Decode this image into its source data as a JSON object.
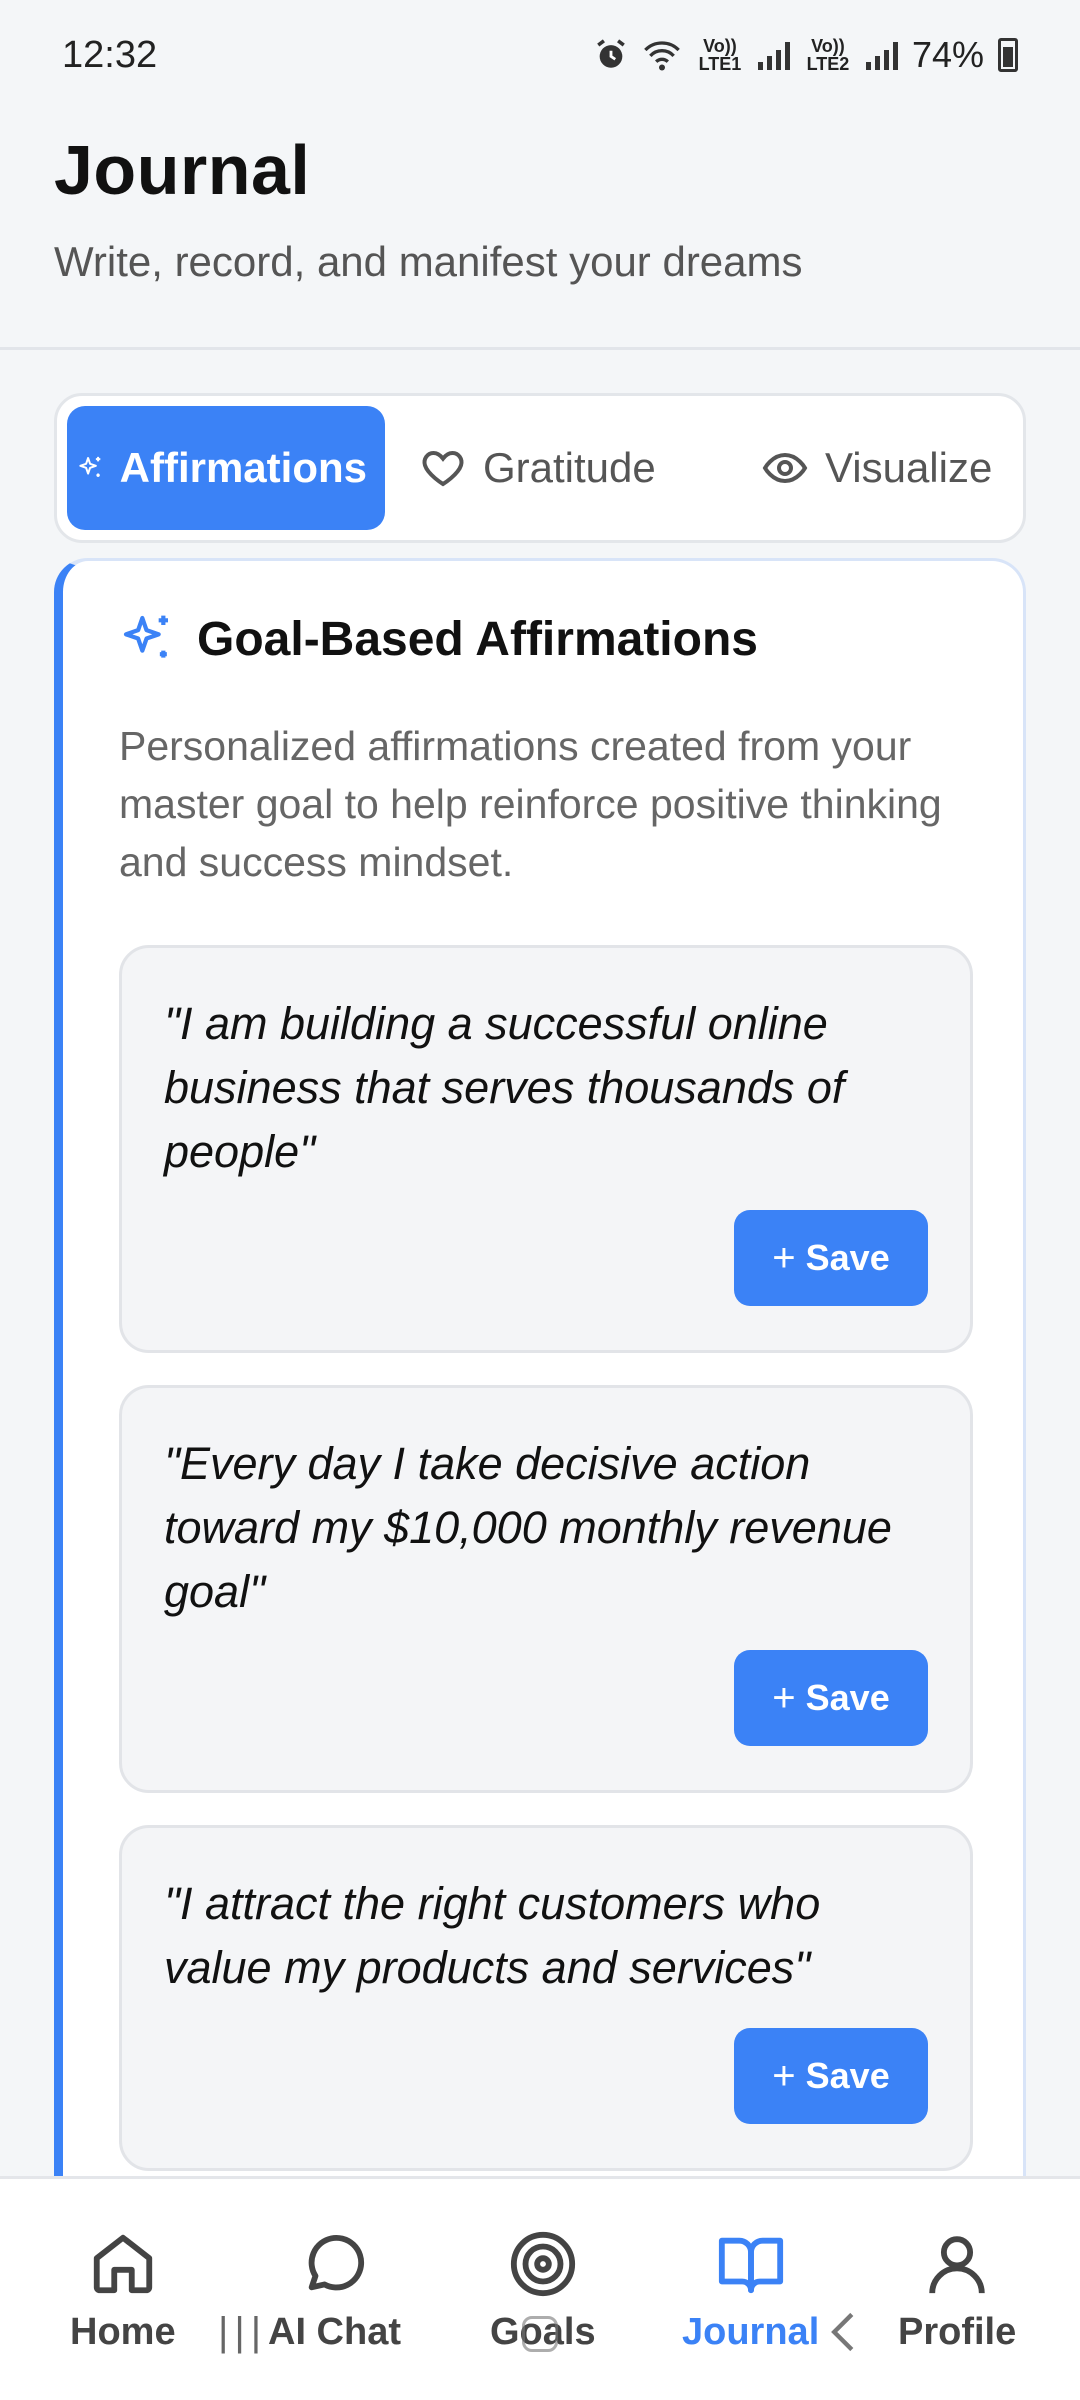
{
  "status": {
    "time": "12:32",
    "sim1": "Vo)) LTE1",
    "sim2": "Vo)) LTE2",
    "battery": "74%"
  },
  "header": {
    "title": "Journal",
    "subtitle": "Write, record, and manifest your dreams"
  },
  "tabs": [
    {
      "label": "Affirmations",
      "icon": "sparkles-icon",
      "active": true
    },
    {
      "label": "Gratitude",
      "icon": "heart-icon",
      "active": false
    },
    {
      "label": "Visualize",
      "icon": "eye-icon",
      "active": false
    }
  ],
  "card": {
    "title": "Goal-Based Affirmations",
    "description": "Personalized affirmations created from your master goal to help reinforce positive thinking and success mindset.",
    "affirmations": [
      {
        "text": "\"I am building a successful online business that serves thousands of people\"",
        "save_label": "Save"
      },
      {
        "text": "\"Every day I take decisive action toward my $10,000 monthly revenue goal\"",
        "save_label": "Save"
      },
      {
        "text": "\"I attract the right customers who value my products and services\"",
        "save_label": "Save"
      }
    ]
  },
  "nav": [
    {
      "label": "Home",
      "icon": "home-icon",
      "active": false
    },
    {
      "label": "AI Chat",
      "icon": "chat-bubble-icon",
      "active": false
    },
    {
      "label": "Goals",
      "icon": "target-icon",
      "active": false
    },
    {
      "label": "Journal",
      "icon": "book-icon",
      "active": true
    },
    {
      "label": "Profile",
      "icon": "user-icon",
      "active": false
    }
  ],
  "colors": {
    "accent": "#3b82f6",
    "background": "#f4f6f8"
  }
}
